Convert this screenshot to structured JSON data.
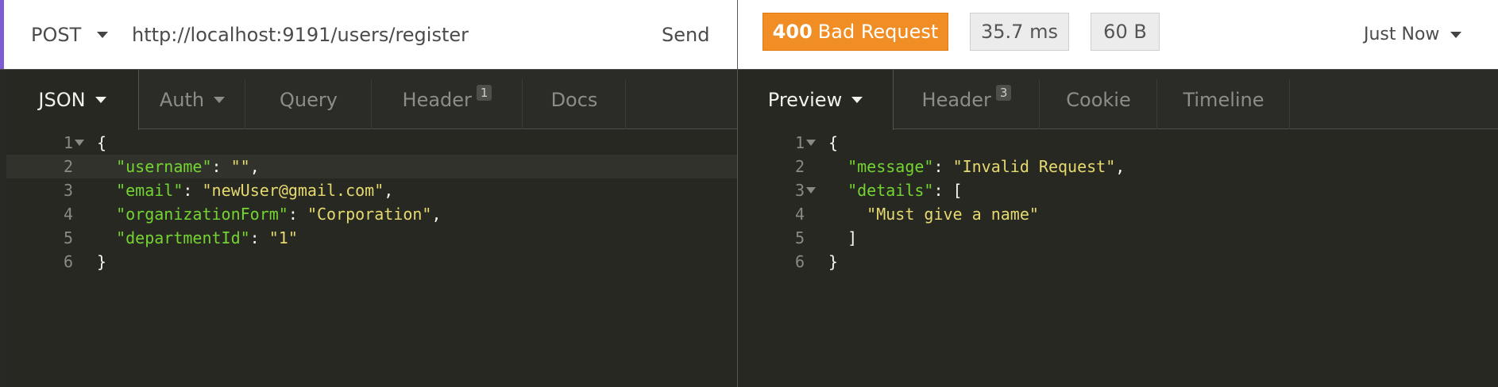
{
  "request": {
    "method": "POST",
    "url": "http://localhost:9191/users/register",
    "send_label": "Send"
  },
  "response": {
    "status_code": "400",
    "status_text": "Bad Request",
    "time": "35.7 ms",
    "size": "60 B",
    "history_label": "Just Now"
  },
  "request_tabs": [
    {
      "label": "JSON",
      "active": true
    },
    {
      "label": "Auth"
    },
    {
      "label": "Query"
    },
    {
      "label": "Header",
      "count": "1"
    },
    {
      "label": "Docs"
    }
  ],
  "response_tabs": [
    {
      "label": "Preview",
      "active": true
    },
    {
      "label": "Header",
      "count": "3"
    },
    {
      "label": "Cookie"
    },
    {
      "label": "Timeline"
    }
  ],
  "request_body": {
    "lines": [
      {
        "n": "1",
        "fold": true,
        "tokens": [
          {
            "t": "p",
            "v": "{"
          }
        ]
      },
      {
        "n": "2",
        "tokens": [
          {
            "t": "p",
            "v": "  "
          },
          {
            "t": "k",
            "v": "\"username\""
          },
          {
            "t": "p",
            "v": ": "
          },
          {
            "t": "s",
            "v": "\"\""
          },
          {
            "t": "p",
            "v": ","
          }
        ]
      },
      {
        "n": "3",
        "tokens": [
          {
            "t": "p",
            "v": "  "
          },
          {
            "t": "k",
            "v": "\"email\""
          },
          {
            "t": "p",
            "v": ": "
          },
          {
            "t": "s",
            "v": "\"newUser@gmail.com\""
          },
          {
            "t": "p",
            "v": ","
          }
        ]
      },
      {
        "n": "4",
        "tokens": [
          {
            "t": "p",
            "v": "  "
          },
          {
            "t": "k",
            "v": "\"organizationForm\""
          },
          {
            "t": "p",
            "v": ": "
          },
          {
            "t": "s",
            "v": "\"Corporation\""
          },
          {
            "t": "p",
            "v": ","
          }
        ]
      },
      {
        "n": "5",
        "tokens": [
          {
            "t": "p",
            "v": "  "
          },
          {
            "t": "k",
            "v": "\"departmentId\""
          },
          {
            "t": "p",
            "v": ": "
          },
          {
            "t": "s",
            "v": "\"1\""
          }
        ]
      },
      {
        "n": "6",
        "tokens": [
          {
            "t": "p",
            "v": "}"
          }
        ]
      }
    ]
  },
  "response_body": {
    "lines": [
      {
        "n": "1",
        "fold": true,
        "tokens": [
          {
            "t": "p",
            "v": "{"
          }
        ]
      },
      {
        "n": "2",
        "tokens": [
          {
            "t": "p",
            "v": "  "
          },
          {
            "t": "k",
            "v": "\"message\""
          },
          {
            "t": "p",
            "v": ": "
          },
          {
            "t": "s",
            "v": "\"Invalid Request\""
          },
          {
            "t": "p",
            "v": ","
          }
        ]
      },
      {
        "n": "3",
        "fold": true,
        "tokens": [
          {
            "t": "p",
            "v": "  "
          },
          {
            "t": "k",
            "v": "\"details\""
          },
          {
            "t": "p",
            "v": ": ["
          }
        ]
      },
      {
        "n": "4",
        "tokens": [
          {
            "t": "p",
            "v": "    "
          },
          {
            "t": "s",
            "v": "\"Must give a name\""
          }
        ]
      },
      {
        "n": "5",
        "tokens": [
          {
            "t": "p",
            "v": "  ]"
          }
        ]
      },
      {
        "n": "6",
        "tokens": [
          {
            "t": "p",
            "v": "}"
          }
        ]
      }
    ]
  },
  "colors": {
    "status_warning": "#f08d24",
    "accent": "#7e5cd6",
    "editor_bg": "#272822",
    "json_key": "#74d432",
    "json_string": "#e6d96f"
  }
}
